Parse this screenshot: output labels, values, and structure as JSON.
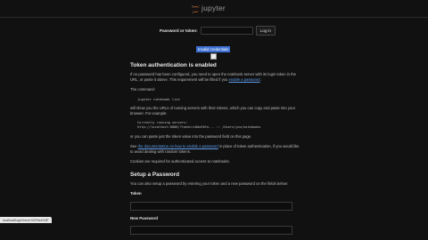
{
  "header": {
    "logo_text": "jupyter"
  },
  "login": {
    "label": "Password or token:",
    "button": "Log in",
    "password_value": "",
    "password_placeholder": ""
  },
  "alert": {
    "text": "Invalid credentials"
  },
  "token_section": {
    "heading": "Token authentication is enabled",
    "p1_a": "If no password has been configured, you need to open the notebook server with its login token in the URL, or paste it above. This requirement will be lifted if you ",
    "p1_link": "enable a password",
    "p1_b": ".",
    "p2": "The command:",
    "command": "jupyter notebook list",
    "p3": "will show you the URLs of running servers with their tokens, which you can copy and paste into your browser. For example:",
    "example_line1": "Currently running servers:",
    "example_line2": "http://localhost:8888/?token=c8de56fa... :: /Users/you/notebooks",
    "p4": "or you can paste just the token value into the password field on this page.",
    "p5_a": "See ",
    "p5_link": "the documentation on how to enable a password",
    "p5_b": " in place of token authentication, if you would like to avoid dealing with random tokens.",
    "p6": "Cookies are required for authenticated access to notebooks."
  },
  "setup_section": {
    "heading": "Setup a Password",
    "intro": "You can also setup a password by entering your token and a new password on the fields below:",
    "token_label": "Token",
    "new_password_label": "New Password"
  },
  "status_bar": {
    "text": "localhost/login?next=%2Ftree%3F"
  },
  "colors": {
    "background": "#111111",
    "accent": "#3c6fd1",
    "link": "#5f9dea",
    "logo_orange": "#f37726"
  },
  "icons": {
    "logo": "jupyter-logo-icon",
    "broken_image": "broken-image-icon"
  }
}
